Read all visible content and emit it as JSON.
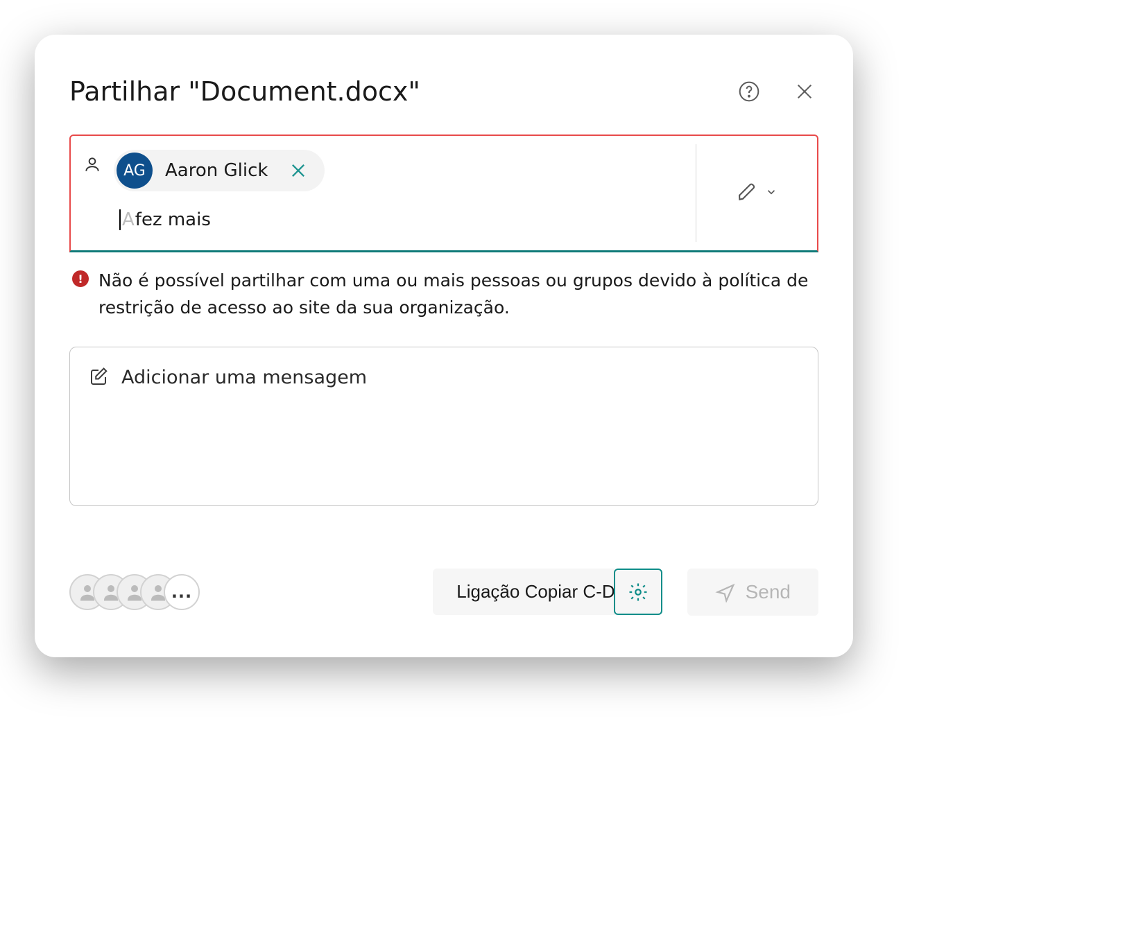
{
  "dialog": {
    "title": "Partilhar \"Document.docx\""
  },
  "recipient": {
    "initials": "AG",
    "name": "Aaron Glick"
  },
  "input": {
    "ghost_char": "A",
    "typed": "fez mais"
  },
  "error": {
    "badge": "!",
    "text": "Não é possível partilhar com uma ou mais pessoas ou grupos devido à política de restrição de acesso ao site da sua organização."
  },
  "message": {
    "placeholder": "Adicionar uma mensagem"
  },
  "avatar_stack": {
    "more": "..."
  },
  "footer": {
    "copy_link": "Ligação Copiar C-D",
    "send": "Send"
  }
}
